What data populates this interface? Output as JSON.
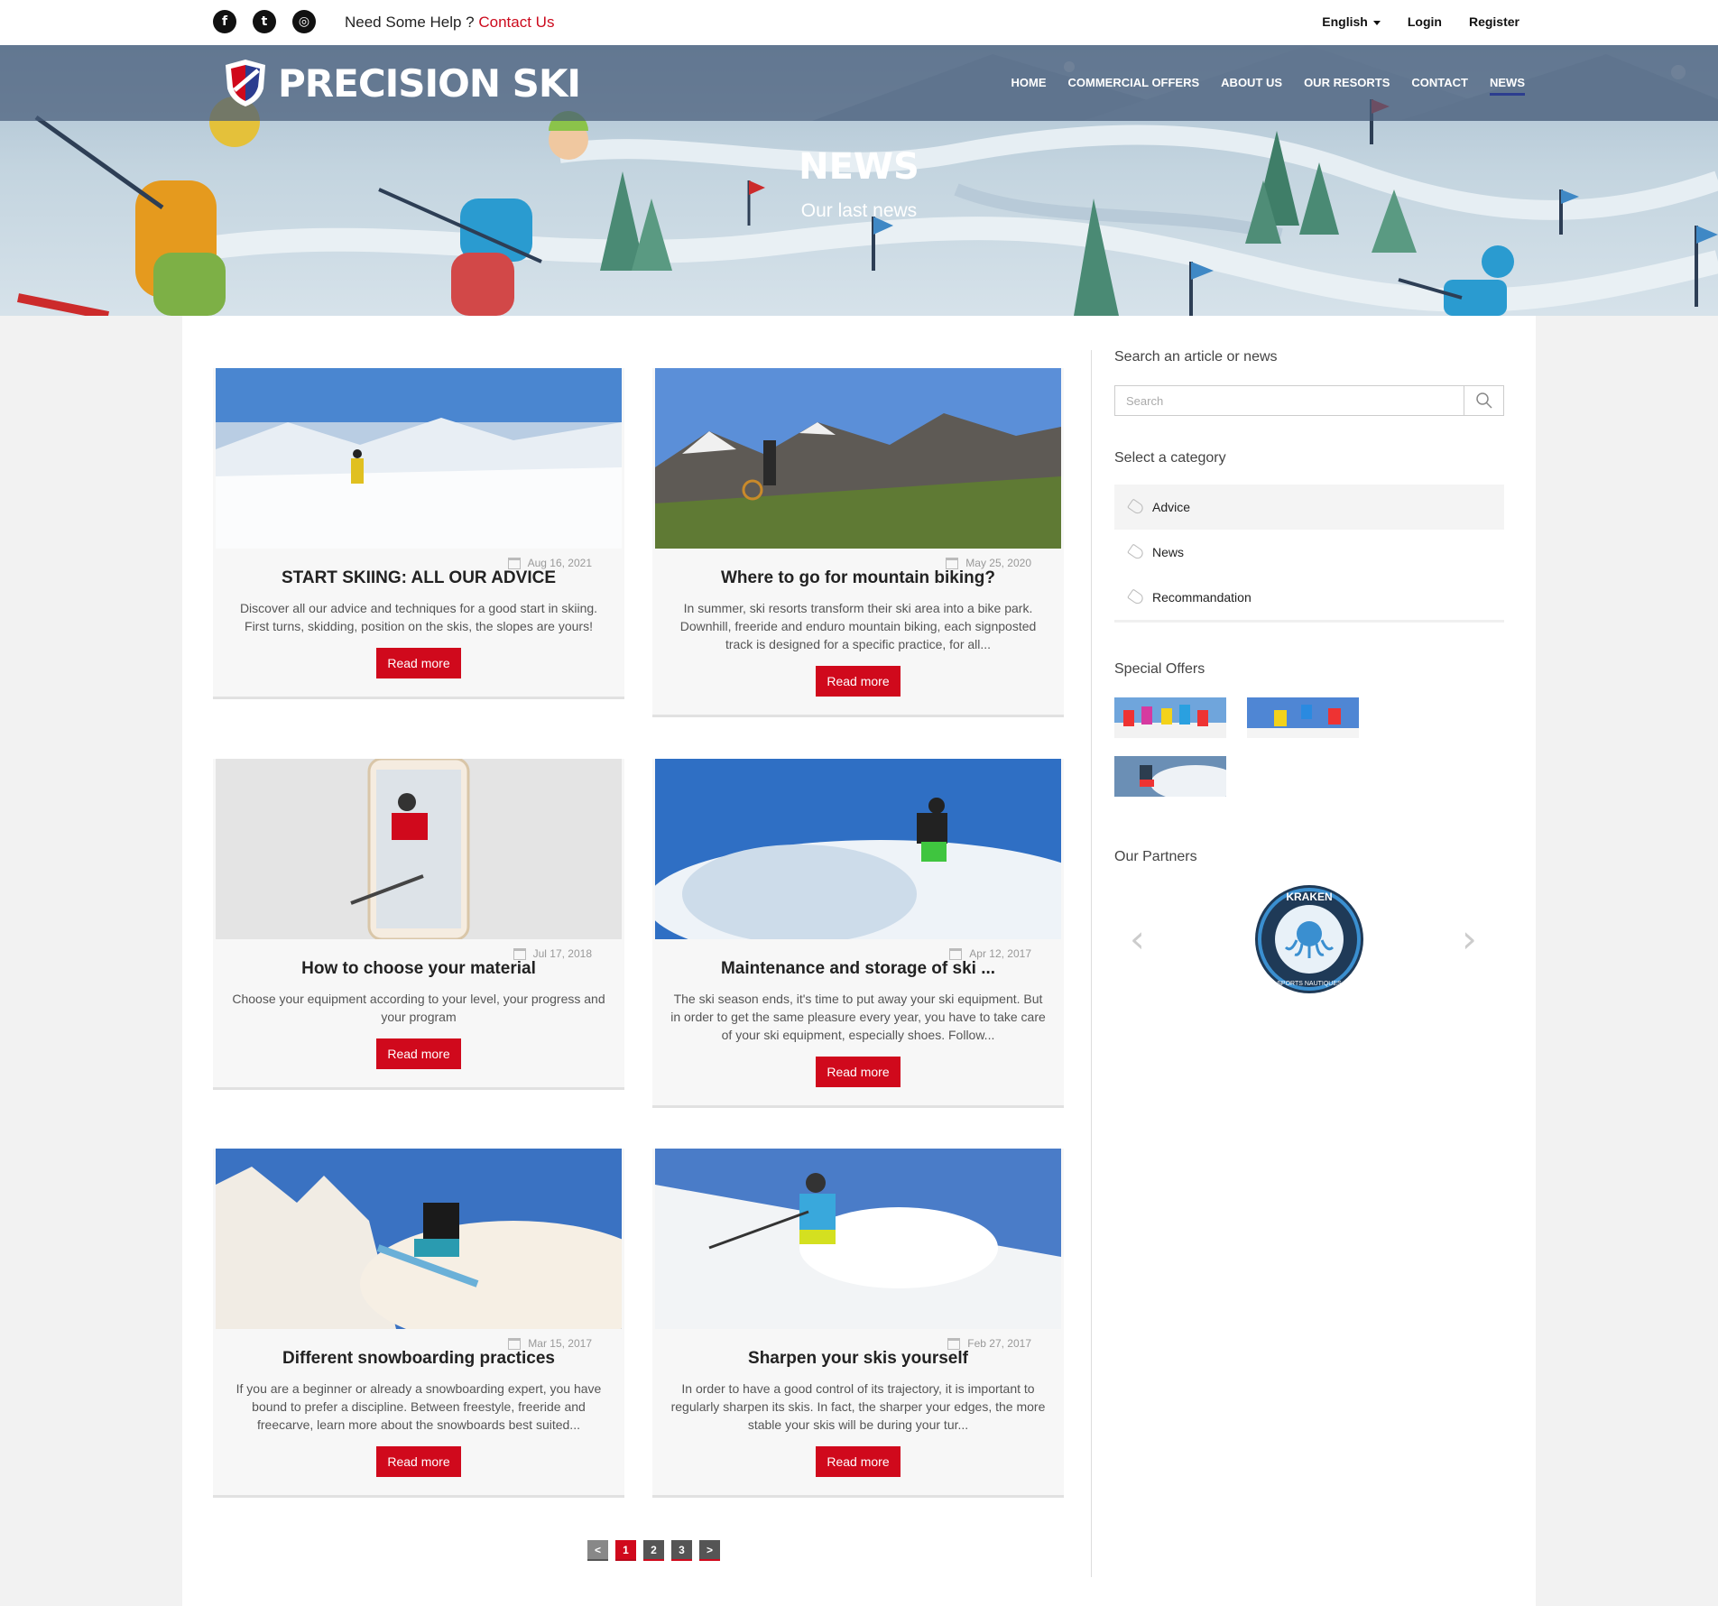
{
  "topbar": {
    "social": [
      {
        "icon": "facebook-icon",
        "glyph": "f"
      },
      {
        "icon": "twitter-icon",
        "glyph": "t"
      },
      {
        "icon": "instagram-icon",
        "glyph": "◎"
      }
    ],
    "help_text": "Need Some Help ?",
    "contact_link": "Contact Us",
    "language": "English",
    "login": "Login",
    "register": "Register"
  },
  "header": {
    "brand": "PRECISION SKI",
    "nav": [
      "HOME",
      "COMMERCIAL OFFERS",
      "ABOUT US",
      "OUR RESORTS",
      "CONTACT",
      "NEWS"
    ],
    "active_nav": "NEWS",
    "title": "NEWS",
    "subtitle": "Our last news"
  },
  "articles": [
    {
      "title": "START SKIING: ALL OUR ADVICE",
      "date": "Aug 16, 2021",
      "excerpt": "Discover all our advice and techniques for a good start in skiing. First turns, skidding, position on the skis, the slopes are yours!",
      "read_more": "Read more"
    },
    {
      "title": "Where to go for mountain biking?",
      "date": "May 25, 2020",
      "excerpt": "In summer, ski resorts transform their ski area into a bike park. Downhill, freeride and enduro mountain biking, each signposted track is designed for a specific practice, for all...",
      "read_more": "Read more"
    },
    {
      "title": "How to choose your material",
      "date": "Jul 17, 2018",
      "excerpt": "Choose your equipment according to your level, your progress and your program",
      "read_more": "Read more"
    },
    {
      "title": "Maintenance and storage of ski ...",
      "date": "Apr 12, 2017",
      "excerpt": "The ski season ends, it's time to put away your ski equipment. But in order to get the same pleasure every year, you have to take care of your ski equipment, especially shoes. Follow...",
      "read_more": "Read more"
    },
    {
      "title": "Different snowboarding practices",
      "date": "Mar 15, 2017",
      "excerpt": "If you are a beginner or already a snowboarding expert, you have bound to prefer a discipline. Between freestyle, freeride and freecarve, learn more about the snowboards best suited...",
      "read_more": "Read more"
    },
    {
      "title": "Sharpen your skis yourself",
      "date": "Feb 27, 2017",
      "excerpt": "In order to have a good control of its trajectory, it is important to regularly sharpen its skis. In fact, the sharper your edges, the more stable your skis will be during your tur...",
      "read_more": "Read more"
    }
  ],
  "pagination": {
    "prev": "<",
    "pages": [
      "1",
      "2",
      "3"
    ],
    "current": "1",
    "next": ">"
  },
  "sidebar": {
    "search_heading": "Search an article or news",
    "search_placeholder": "Search",
    "category_heading": "Select a category",
    "categories": [
      "Advice",
      "News",
      "Recommandation"
    ],
    "offers_heading": "Special Offers",
    "partners_heading": "Our Partners",
    "partner_name": "KRAKEN",
    "partner_tagline": "SPORTS NAUTIQUES"
  },
  "colors": {
    "accent_red": "#d0091c",
    "nav_active": "#2c3d8f",
    "link_red": "#cc0a1d"
  }
}
